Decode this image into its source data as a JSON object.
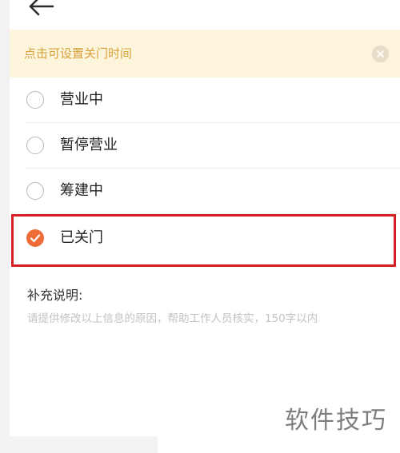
{
  "nav": {
    "back_icon": "arrow-left-icon"
  },
  "notice": {
    "text": "点击可设置关门时间",
    "close_icon": "close-circle-icon"
  },
  "status_options": [
    {
      "label": "营业中",
      "selected": false
    },
    {
      "label": "暂停营业",
      "selected": false
    },
    {
      "label": "筹建中",
      "selected": false
    },
    {
      "label": "已关门",
      "selected": true
    }
  ],
  "note": {
    "title": "补充说明:",
    "placeholder": "请提供修改以上信息的原因，帮助工作人员核实，150字以内"
  },
  "watermark": {
    "text": "软件技巧"
  },
  "colors": {
    "accent": "#ee6c38",
    "notice_bg": "#fdf4dc",
    "notice_text": "#d8a23a",
    "highlight_border": "#d61e24"
  }
}
